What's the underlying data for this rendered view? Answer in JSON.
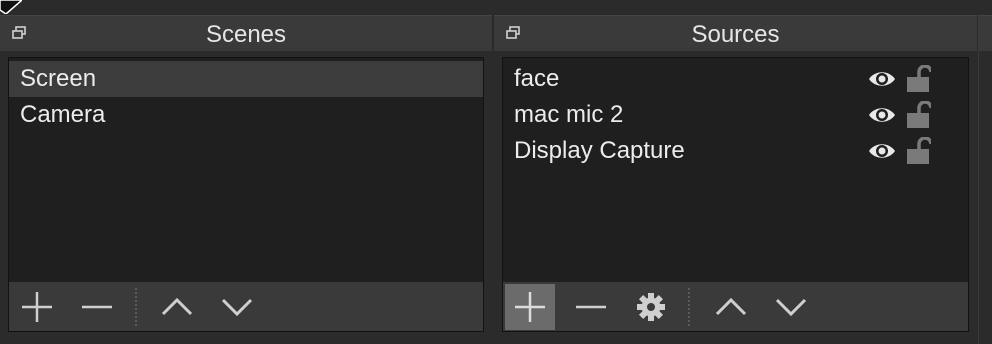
{
  "scenes": {
    "title": "Scenes",
    "items": [
      {
        "label": "Screen",
        "selected": true
      },
      {
        "label": "Camera",
        "selected": false
      }
    ],
    "toolbar": [
      "add-icon",
      "remove-icon",
      "move-up-icon",
      "move-down-icon"
    ]
  },
  "sources": {
    "title": "Sources",
    "items": [
      {
        "label": "face",
        "visible": true,
        "locked": false
      },
      {
        "label": "mac mic 2",
        "visible": true,
        "locked": false
      },
      {
        "label": "Display Capture",
        "visible": true,
        "locked": false
      }
    ],
    "toolbar": [
      "add-icon",
      "remove-icon",
      "gear-icon",
      "move-up-icon",
      "move-down-icon"
    ],
    "active_toolbar_button": "add-icon"
  },
  "colors": {
    "background": "#2b2b2b",
    "title_bar": "#3a3a3a",
    "list_background": "#1f1f1f",
    "selected_row": "#3c3c3c",
    "text": "#e6e6e6",
    "icon": "#cfcfcf"
  }
}
